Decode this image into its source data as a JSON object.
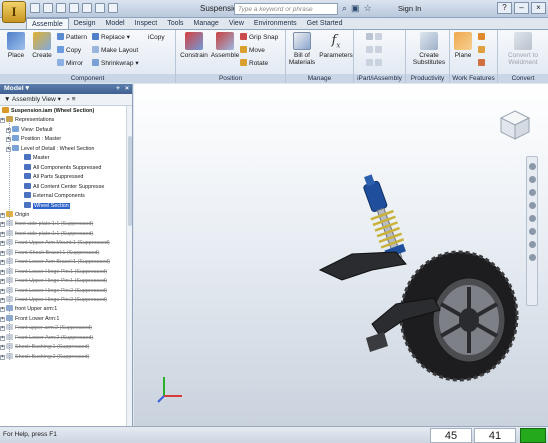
{
  "window": {
    "title": "Suspension.ia",
    "search_placeholder": "Type a keyword or phrase",
    "sign_in": "Sign In"
  },
  "tabs": [
    "Assemble",
    "Design",
    "Model",
    "Inspect",
    "Tools",
    "Manage",
    "View",
    "Environments",
    "Get Started"
  ],
  "ribbon": {
    "component": {
      "label": "Component",
      "place": "Place",
      "create": "Create",
      "pattern": "Pattern",
      "copy": "Copy",
      "mirror": "Mirror",
      "replace": "Replace",
      "make_layout": "Make Layout",
      "shrinkwrap": "Shrinkwrap",
      "icopy": "iCopy"
    },
    "position": {
      "label": "Position",
      "constrain": "Constrain",
      "assemble": "Assemble",
      "grip_snap": "Grip Snap",
      "move": "Move",
      "rotate": "Rotate"
    },
    "manage": {
      "label": "Manage",
      "bill_line1": "Bill of",
      "bill_line2": "Materials",
      "parameters": "Parameters"
    },
    "ipart": {
      "label": "iPart/iAssembly"
    },
    "productivity": {
      "label": "Productivity",
      "create_line1": "Create",
      "create_line2": "Substitutes"
    },
    "work": {
      "label": "Work Features",
      "plane": "Plane"
    },
    "convert": {
      "label": "Convert",
      "line1": "Convert to",
      "line2": "Weldment"
    }
  },
  "browser": {
    "header": "Model",
    "toolbar": "Assembly View",
    "nodes": [
      {
        "text": "Suspension.iam (Wheel Section)",
        "bold": true
      },
      {
        "text": "Representations"
      },
      {
        "text": "View: Default"
      },
      {
        "text": "Position : Master"
      },
      {
        "text": "Level of Detail : Wheel Section"
      },
      {
        "text": "Master"
      },
      {
        "text": "All Components Suppressed"
      },
      {
        "text": "All Parts Suppressed"
      },
      {
        "text": "All Content Center Suppresse"
      },
      {
        "text": "External Components"
      },
      {
        "text": "Wheel Section",
        "selected": true
      },
      {
        "text": "Origin"
      },
      {
        "text": "front side plate:1:1 (Suppressed)",
        "suppressed": true
      },
      {
        "text": "front side plate:1:1 (Suppressed)",
        "suppressed": true
      },
      {
        "text": "Front Upper Arm Mount:1 (Suppressed)",
        "suppressed": true
      },
      {
        "text": "Front Shock Bracel:1 (Suppressed)",
        "suppressed": true
      },
      {
        "text": "Front Lower Arm Bracel:1 (Suppressed)",
        "suppressed": true
      },
      {
        "text": "Front Lower Hinge Pin:1 (Suppressed)",
        "suppressed": true
      },
      {
        "text": "Front Upper Hinge Pin:1 (Suppressed)",
        "suppressed": true
      },
      {
        "text": "Front Lower Hinge Pin:2 (Suppressed)",
        "suppressed": true
      },
      {
        "text": "Front Upper Hinge Pin:2 (Suppressed)",
        "suppressed": true
      },
      {
        "text": "front Upper arm:1"
      },
      {
        "text": "Front Lower Arm:1"
      },
      {
        "text": "Front upper arm:2 (Suppressed)",
        "suppressed": true
      },
      {
        "text": "Front Lower Arm:2 (Suppressed)",
        "suppressed": true
      },
      {
        "text": "Shock Bushing:1 (Suppressed)",
        "suppressed": true
      },
      {
        "text": "Shock Bushing:2 (Suppressed)",
        "suppressed": true
      }
    ]
  },
  "status": {
    "help": "For Help, press F1",
    "count1": "45",
    "count2": "41"
  },
  "colors": {
    "accent": "#2f64c8",
    "status_green": "#24a81c",
    "ribbon_label": "#c9d6e6"
  }
}
